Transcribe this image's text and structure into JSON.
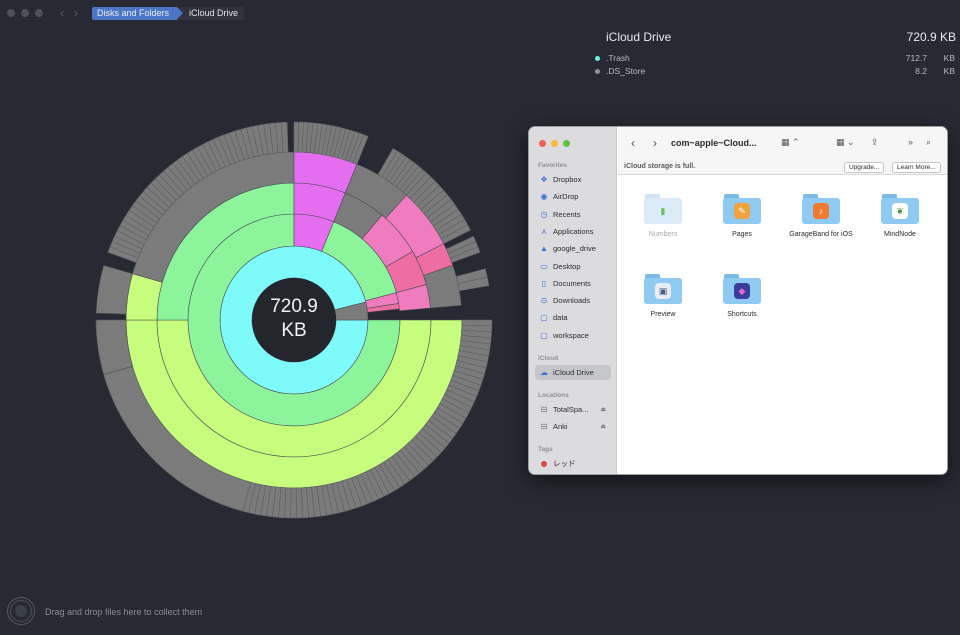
{
  "window": {
    "breadcrumbs": [
      "Disks and Folders",
      "iCloud Drive"
    ],
    "nav_back": "‹",
    "nav_forward": "›"
  },
  "info": {
    "title": "iCloud Drive",
    "total": "720.9 KB",
    "items": [
      {
        "name": ".Trash",
        "value": "712.7",
        "unit": "KB",
        "color": "#6ff0d8"
      },
      {
        "name": ".DS_Store",
        "value": "8.2",
        "unit": "KB",
        "color": "#8f9298"
      }
    ]
  },
  "sunburst": {
    "center_value": "720.9",
    "center_unit": "KB",
    "colors": {
      "ring1": "#7ffafa",
      "ring2": "#8cf59c",
      "ring3": "#c6fd7c",
      "gray": "#7b7b7b",
      "magenta": "#e46df0",
      "pink": "#ee7cbe",
      "hotpink": "#ee6ea4",
      "center": "#24262d",
      "background": "#272a33"
    }
  },
  "drop_zone": {
    "text": "Drag and drop files here to collect them"
  },
  "finder": {
    "path_title": "com~apple~Cloud...",
    "back": "‹",
    "forward": "›",
    "banner": {
      "message": "iCloud storage is full.",
      "upgrade": "Upgrade...",
      "learn_more": "Learn More..."
    },
    "sidebar": {
      "favorites_header": "Favorites",
      "favorites": [
        {
          "label": "Dropbox",
          "icon": "dropbox-icon",
          "glyph": "❖"
        },
        {
          "label": "AirDrop",
          "icon": "airdrop-icon",
          "glyph": "◉"
        },
        {
          "label": "Recents",
          "icon": "recents-icon",
          "glyph": "◷"
        },
        {
          "label": "Applications",
          "icon": "applications-icon",
          "glyph": "⋏"
        },
        {
          "label": "google_drive",
          "icon": "google-drive-icon",
          "glyph": "▲"
        },
        {
          "label": "Desktop",
          "icon": "desktop-icon",
          "glyph": "▭"
        },
        {
          "label": "Documents",
          "icon": "documents-icon",
          "glyph": "▯"
        },
        {
          "label": "Downloads",
          "icon": "downloads-icon",
          "glyph": "⊙"
        },
        {
          "label": "data",
          "icon": "folder-icon",
          "glyph": "▢"
        },
        {
          "label": "workspace",
          "icon": "folder-icon",
          "glyph": "▢"
        }
      ],
      "icloud_header": "iCloud",
      "icloud_item": {
        "label": "iCloud Drive",
        "glyph": "☁"
      },
      "locations_header": "Locations",
      "locations": [
        {
          "label": "TotalSpa...",
          "glyph": "⊟",
          "eject": "⏏"
        },
        {
          "label": "Anki",
          "glyph": "⊟",
          "eject": "⏏"
        }
      ],
      "tags_header": "Tags",
      "tag": {
        "label": "レッド",
        "color": "#e04a3c"
      }
    },
    "files": [
      {
        "name": "Numbers",
        "dim": true,
        "glyph": "▮",
        "glyph_bg": "#d9ecfa",
        "glyph_color": "#69c15c"
      },
      {
        "name": "Pages",
        "dim": false,
        "glyph": "✎",
        "glyph_bg": "#f4a23c",
        "glyph_color": "#ffffff"
      },
      {
        "name": "GarageBand for iOS",
        "dim": false,
        "glyph": "♪",
        "glyph_bg": "#f07a30",
        "glyph_color": "#ffffff"
      },
      {
        "name": "MindNode",
        "dim": false,
        "glyph": "❦",
        "glyph_bg": "#ffffff",
        "glyph_color": "#3d8f3a"
      },
      {
        "name": "Preview",
        "dim": false,
        "glyph": "▣",
        "glyph_bg": "#e9edf3",
        "glyph_color": "#4a5a7a"
      },
      {
        "name": "Shortcuts",
        "dim": false,
        "glyph": "◆",
        "glyph_bg": "#3b3f9c",
        "glyph_color": "#e86ad8"
      }
    ]
  }
}
